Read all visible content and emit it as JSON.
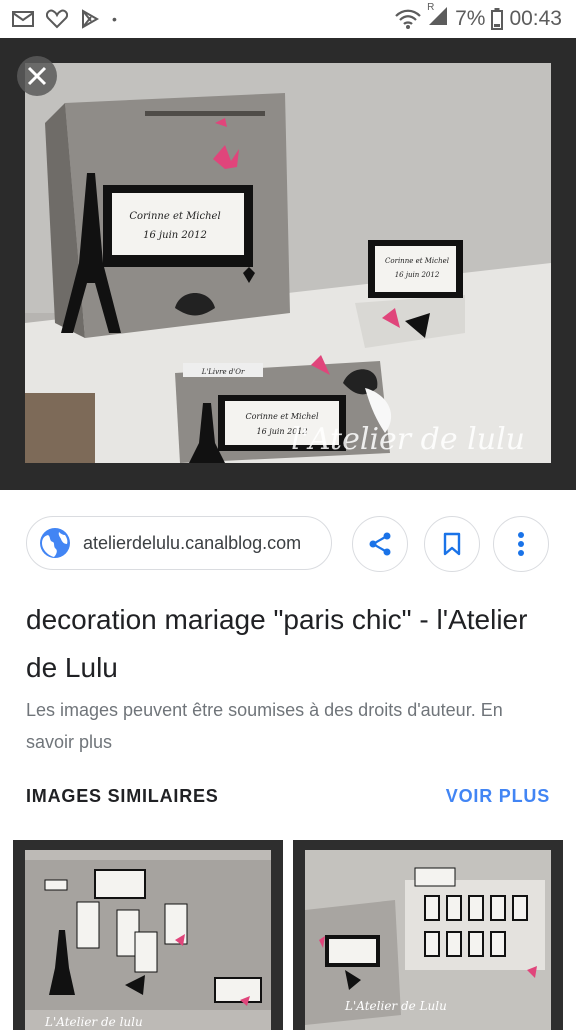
{
  "status_bar": {
    "battery": "7%",
    "time": "00:43",
    "sim_label": "R"
  },
  "viewer": {
    "watermark": "l'Atelier de lulu",
    "cards": {
      "big": [
        "Corinne et Michel",
        "16 juin 2012"
      ],
      "small": [
        "Corinne et Michel",
        "16 juin 2012"
      ],
      "book": [
        "Corinne et Michel",
        "16 juin 2012"
      ],
      "tag": "L'Livre d'Or"
    }
  },
  "source": {
    "domain": "atelierdelulu.canalblog.com"
  },
  "title": "decoration mariage \"paris chic\" - l'Atelier de Lulu",
  "notice": "Les images peuvent être soumises à des droits d'auteur. En savoir plus",
  "similar": {
    "heading": "IMAGES SIMILAIRES",
    "more": "VOIR PLUS",
    "thumb1_watermark": "L'Atelier de lulu",
    "thumb2_watermark": "L'Atelier de Lulu"
  },
  "colors": {
    "accent": "#4285f4",
    "pink": "#e0457b"
  },
  "icons": [
    "mail-icon",
    "heart-icon",
    "play-store-icon",
    "wifi-icon",
    "signal-icon",
    "battery-icon",
    "close-icon",
    "globe-icon",
    "share-icon",
    "bookmark-icon",
    "more-vert-icon"
  ]
}
